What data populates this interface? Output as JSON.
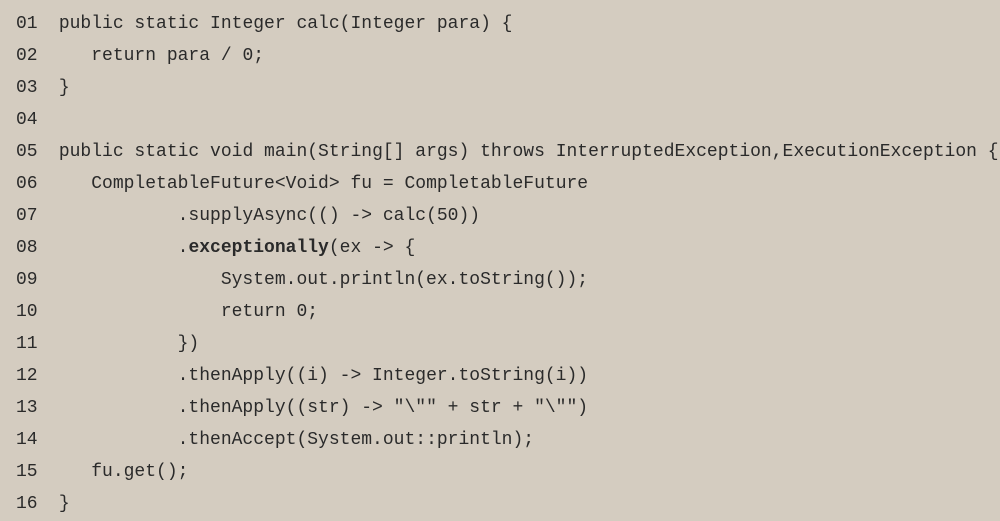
{
  "code_lines": [
    {
      "num": "01",
      "content": "public static Integer calc(Integer para) {",
      "indent": 1
    },
    {
      "num": "02",
      "content": "return para / 0;",
      "indent": 4
    },
    {
      "num": "03",
      "content": "}",
      "indent": 1
    },
    {
      "num": "04",
      "content": "",
      "indent": 0
    },
    {
      "num": "05",
      "content": "public static void main(String[] args) throws InterruptedException,ExecutionException {",
      "indent": 1
    },
    {
      "num": "06",
      "content": "CompletableFuture<Void> fu = CompletableFuture",
      "indent": 4
    },
    {
      "num": "07",
      "content": ".supplyAsync(() -> calc(50))",
      "indent": 12
    },
    {
      "num": "08",
      "content_parts": [
        ".",
        "exceptionally",
        "(ex -> {"
      ],
      "bold_index": 1,
      "indent": 12
    },
    {
      "num": "09",
      "content": "System.out.println(ex.toString());",
      "indent": 16
    },
    {
      "num": "10",
      "content": "return 0;",
      "indent": 16
    },
    {
      "num": "11",
      "content": "})",
      "indent": 12
    },
    {
      "num": "12",
      "content": ".thenApply((i) -> Integer.toString(i))",
      "indent": 12
    },
    {
      "num": "13",
      "content": ".thenApply((str) -> \"\\\"\" + str + \"\\\"\")",
      "indent": 12
    },
    {
      "num": "14",
      "content": ".thenAccept(System.out::println);",
      "indent": 12
    },
    {
      "num": "15",
      "content": "fu.get();",
      "indent": 4
    },
    {
      "num": "16",
      "content": "}",
      "indent": 1
    }
  ]
}
